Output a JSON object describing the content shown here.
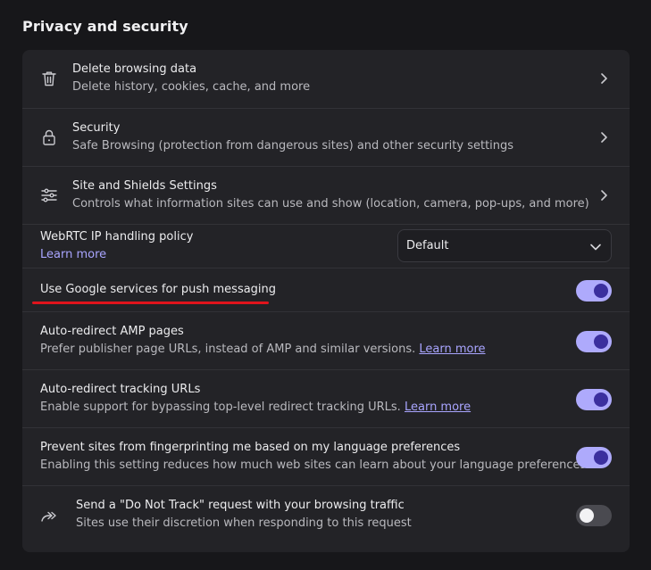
{
  "section": {
    "title": "Privacy and security"
  },
  "rows": {
    "delete_data": {
      "title": "Delete browsing data",
      "subtitle": "Delete history, cookies, cache, and more",
      "icon": "trash-icon"
    },
    "security": {
      "title": "Security",
      "subtitle": "Safe Browsing (protection from dangerous sites) and other security settings",
      "icon": "lock-icon"
    },
    "site_shields": {
      "title": "Site and Shields Settings",
      "subtitle": "Controls what information sites can use and show (location, camera, pop-ups, and more)",
      "icon": "sliders-icon"
    },
    "webrtc": {
      "title": "WebRTC IP handling policy",
      "link": "Learn more",
      "selected": "Default"
    },
    "push_messaging": {
      "title": "Use Google services for push messaging",
      "enabled": true
    },
    "amp": {
      "title": "Auto-redirect AMP pages",
      "subtitle": "Prefer publisher page URLs, instead of AMP and similar versions.",
      "link": "Learn more",
      "enabled": true
    },
    "tracking_urls": {
      "title": "Auto-redirect tracking URLs",
      "subtitle": "Enable support for bypassing top-level redirect tracking URLs.",
      "link": "Learn more",
      "enabled": true
    },
    "fingerprint_lang": {
      "title": "Prevent sites from fingerprinting me based on my language preferences",
      "subtitle": "Enabling this setting reduces how much web sites can learn about your language preferences",
      "enabled": true
    },
    "do_not_track": {
      "title": "Send a \"Do Not Track\" request with your browsing traffic",
      "subtitle": "Sites use their discretion when responding to this request",
      "icon": "forward-arrows-icon",
      "enabled": false
    }
  },
  "colors": {
    "accent": "#aeaafc",
    "knob_on": "#3b2f9e",
    "link": "#a9a5ff",
    "annotation": "#e0141c"
  }
}
